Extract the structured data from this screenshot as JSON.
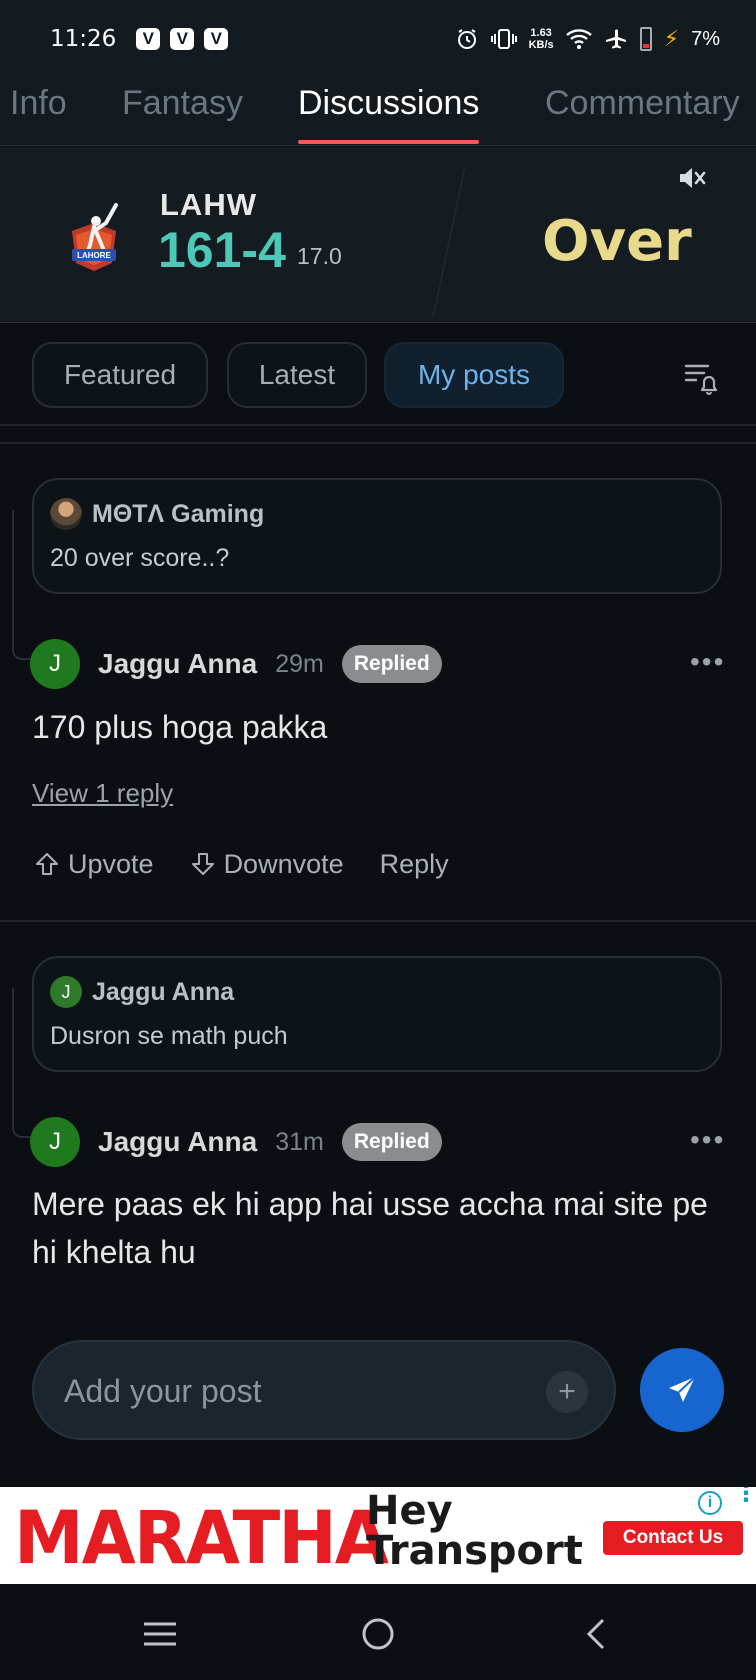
{
  "status_bar": {
    "time": "11:26",
    "badges": [
      "V",
      "V",
      "V"
    ],
    "net_speed_value": "1.63",
    "net_speed_unit": "KB/s",
    "battery": "7%"
  },
  "tabs": [
    {
      "label": "Info",
      "active": false
    },
    {
      "label": "Fantasy",
      "active": false
    },
    {
      "label": "Discussions",
      "active": true
    },
    {
      "label": "Commentary",
      "active": false
    }
  ],
  "score": {
    "logo_text": "LAHORE",
    "team": "LAHW",
    "runs_wickets": "161-4",
    "overs": "17.0",
    "event": "Over"
  },
  "filters": [
    {
      "label": "Featured",
      "active": false
    },
    {
      "label": "Latest",
      "active": false
    },
    {
      "label": "My posts",
      "active": true
    }
  ],
  "posts": [
    {
      "quote": {
        "author": "MΘTΛ Gaming",
        "text": "20 over score..?"
      },
      "avatar_initial": "J",
      "author": "Jaggu Anna",
      "time": "29m",
      "badge": "Replied",
      "body": "170 plus hoga pakka",
      "view_replies": "View 1 reply",
      "actions": {
        "upvote": "Upvote",
        "downvote": "Downvote",
        "reply": "Reply"
      }
    },
    {
      "quote": {
        "author": "Jaggu Anna",
        "avatar_initial": "J",
        "text": "Dusron se math puch"
      },
      "avatar_initial": "J",
      "author": "Jaggu Anna",
      "time": "31m",
      "badge": "Replied",
      "body": "Mere paas ek hi app hai usse accha mai site pe hi khelta hu"
    }
  ],
  "composer": {
    "placeholder": "Add your post"
  },
  "ad": {
    "brand": "MARATHA",
    "tagline_line1": "Hey",
    "tagline_line2": "Transport",
    "cta": "Contact Us"
  },
  "colors": {
    "accent_tab": "#ef5b5b",
    "score": "#4ec9b8",
    "event": "#e9d98a",
    "chip_active": "#6eb3ec",
    "send_button": "#1766cf"
  }
}
